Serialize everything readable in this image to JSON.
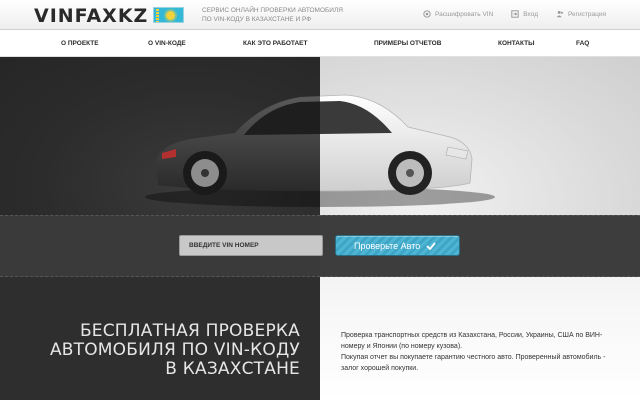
{
  "header": {
    "logo": "VINFAXKZ",
    "tagline": "СЕРВИС ОНЛАЙН ПРОВЕРКИ АВТОМОБИЛЯ ПО VIN-КОДУ В КАЗАХСТАНЕ И РФ",
    "links": [
      {
        "label": "Расшифровать VIN",
        "icon": "target-icon"
      },
      {
        "label": "Вход",
        "icon": "login-icon"
      },
      {
        "label": "Регистрация",
        "icon": "users-icon"
      }
    ]
  },
  "nav": {
    "items": [
      "О ПРОЕКТЕ",
      "О VIN-КОДЕ",
      "КАК ЭТО РАБОТАЕТ",
      "ПРИМЕРЫ ОТЧЕТОВ",
      "КОНТАКТЫ",
      "FAQ"
    ]
  },
  "search": {
    "placeholder": "ВВЕДИТЕ VIN НОМЕР",
    "button_label": "Проверьте Авто"
  },
  "promo": {
    "headline": "БЕСПЛАТНАЯ ПРОВЕРКА АВТОМОБИЛЯ ПО VIN-КОДУ В КАЗАХСТАНЕ",
    "paragraphs": [
      "Проверка транспортных средств из Казахстана, России, Украины, США по ВИН-номеру и Японии (по номеру кузова).",
      "Покупая отчет вы покупаете гарантию честного авто. Проверенный автомобиль - залог хорошей покупки."
    ]
  },
  "colors": {
    "accent": "#4eb6d4",
    "dark": "#2e2e2e",
    "flag_blue": "#33b8d8",
    "flag_gold": "#f1d23a"
  }
}
